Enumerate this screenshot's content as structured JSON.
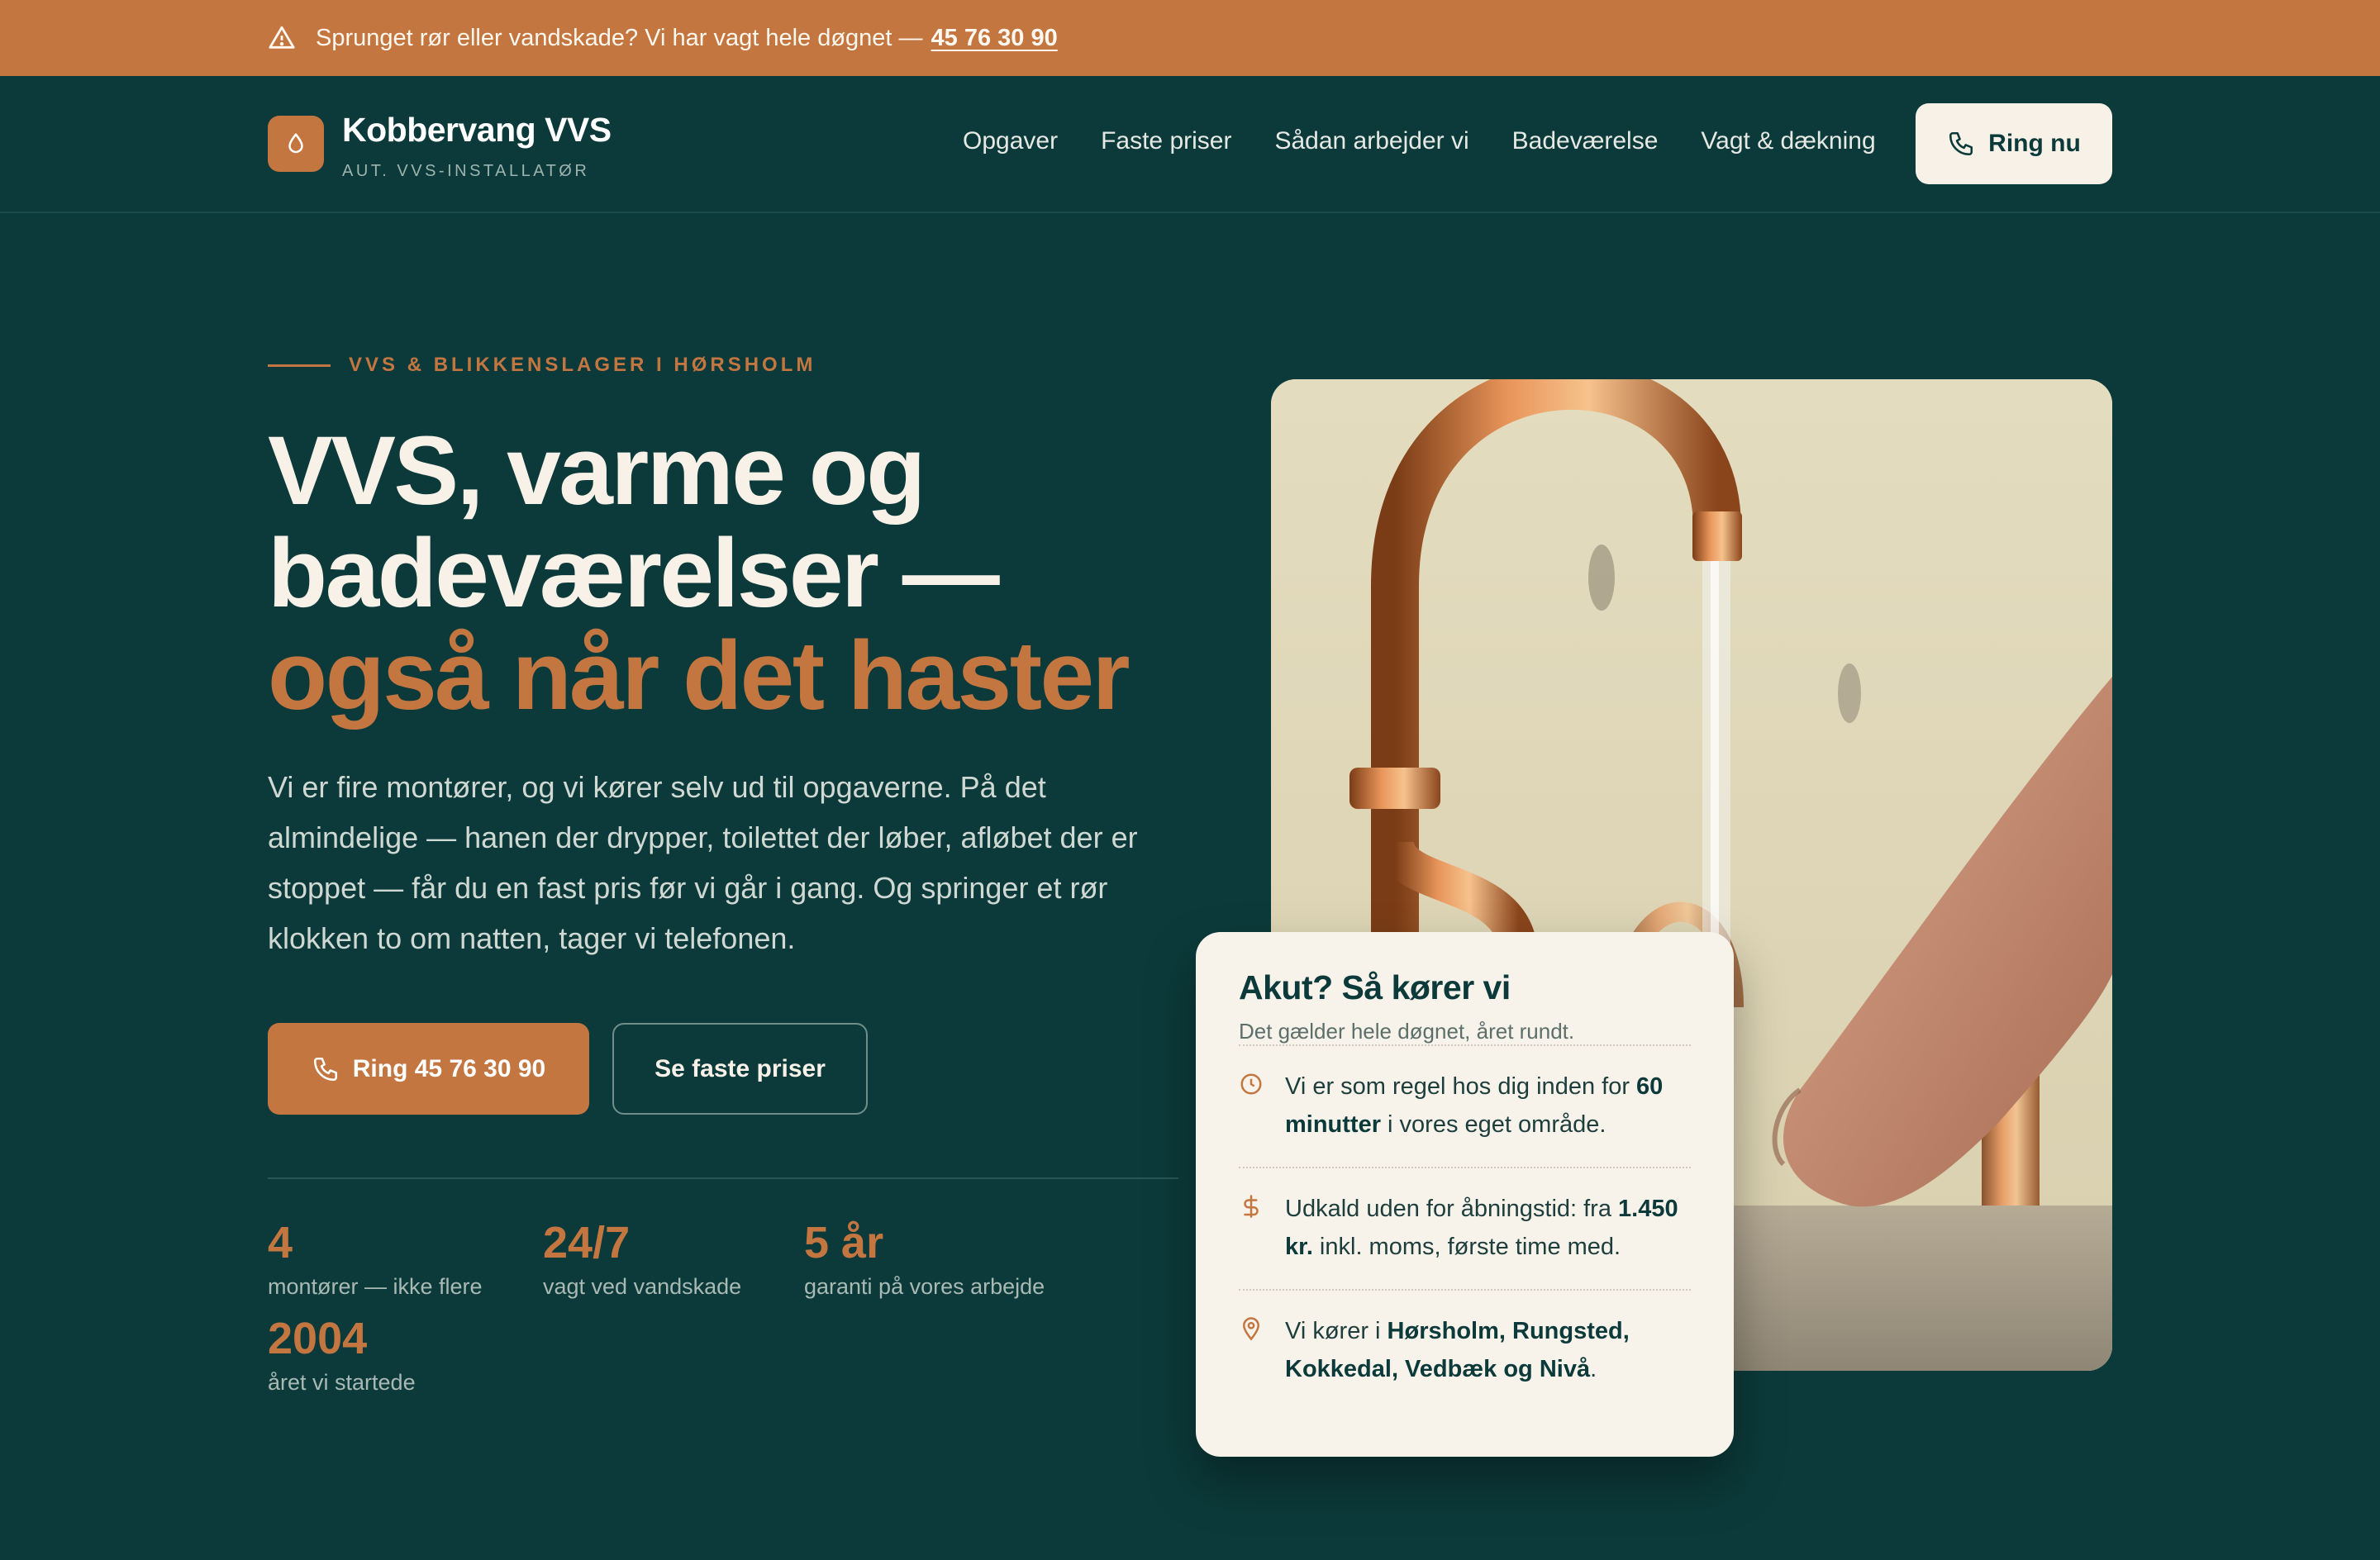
{
  "alert": {
    "text": "Sprunget rør eller vandskade? Vi har vagt hele døgnet —",
    "phone": "45 76 30 90"
  },
  "brand": {
    "name": "Kobbervang VVS",
    "tagline": "AUT. VVS-INSTALLATØR"
  },
  "nav": {
    "items": [
      "Opgaver",
      "Faste priser",
      "Sådan arbejder vi",
      "Badeværelse",
      "Vagt & dækning"
    ],
    "cta": "Ring nu"
  },
  "hero": {
    "eyebrow": "VVS & BLIKKENSLAGER I HØRSHOLM",
    "title_line1": "VVS, varme og",
    "title_line2": "badeværelser —",
    "title_accent": "også når det haster",
    "lead": "Vi er fire montører, og vi kører selv ud til opgaverne. På det almindelige — hanen der drypper, toilettet der løber, afløbet der er stoppet — får du en fast pris før vi går i gang. Og springer et rør klokken to om natten, tager vi telefonen.",
    "cta_primary": "Ring 45 76 30 90",
    "cta_secondary": "Se faste priser"
  },
  "stats": [
    {
      "value": "4",
      "label": "montører — ikke flere"
    },
    {
      "value": "24/7",
      "label": "vagt ved vandskade"
    },
    {
      "value": "5 år",
      "label": "garanti på vores arbejde"
    },
    {
      "value": "2004",
      "label": "året vi startede"
    }
  ],
  "card": {
    "title": "Akut? Så kører vi",
    "subtitle": "Det gælder hele døgnet, året rundt.",
    "row1_a": "Vi er som regel hos dig inden for ",
    "row1_b": "60 minutter",
    "row1_c": " i vores eget område.",
    "row2_a": "Udkald uden for åbningstid: fra ",
    "row2_b": "1.450 kr.",
    "row2_c": " inkl. moms, første time med.",
    "row3_a": "Vi kører i ",
    "row3_b": "Hørsholm, Rungsted, Kokkedal, Vedbæk og Nivå",
    "row3_c": "."
  },
  "icons": {
    "alert": "warning-triangle-icon",
    "logo": "drop-icon",
    "phone": "phone-icon",
    "clock": "clock-icon",
    "price": "dollar-icon",
    "location": "map-pin-icon"
  },
  "colors": {
    "background": "#0c3a3a",
    "accent": "#c47641",
    "cream": "#f7f1e8"
  }
}
